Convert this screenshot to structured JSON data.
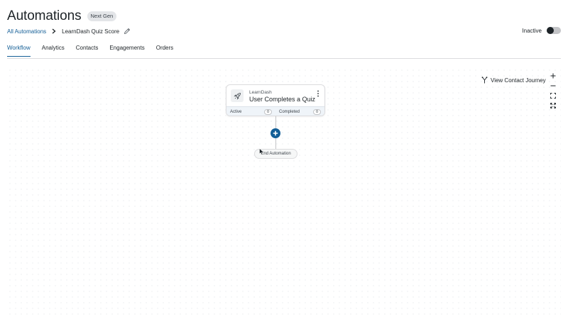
{
  "header": {
    "title": "Automations",
    "badge": "Next Gen"
  },
  "breadcrumb": {
    "root": "All Automations",
    "current": "LearnDash Quiz Score"
  },
  "status": {
    "label": "Inactive",
    "enabled": false
  },
  "tabs": [
    {
      "label": "Workflow",
      "active": true
    },
    {
      "label": "Analytics",
      "active": false
    },
    {
      "label": "Contacts",
      "active": false
    },
    {
      "label": "Engagements",
      "active": false
    },
    {
      "label": "Orders",
      "active": false
    }
  ],
  "canvas": {
    "journey_label": "View Contact Journey",
    "tools": [
      {
        "icon": "plus-icon"
      },
      {
        "icon": "minus-icon"
      },
      {
        "icon": "fit-screen-icon"
      },
      {
        "icon": "fullscreen-icon"
      }
    ]
  },
  "trigger": {
    "integration": "LearnDash",
    "title": "User Completes a Quiz",
    "icon": "rocket-icon",
    "active_label": "Active",
    "active_count": "0",
    "completed_label": "Completed",
    "completed_count": "0"
  },
  "end_node": {
    "label": "End Automation"
  },
  "colors": {
    "accent": "#135e96",
    "text": "#1d2327",
    "stats_bg": "#eff4f9"
  }
}
